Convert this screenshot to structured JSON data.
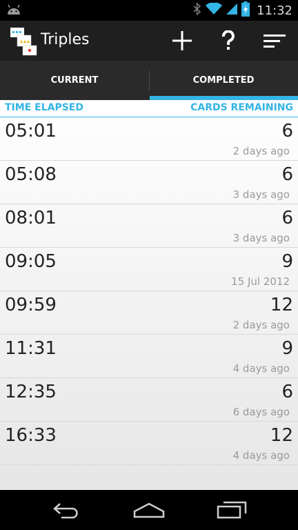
{
  "status_bar": {
    "time": "11:32",
    "icons": [
      "android-icon",
      "bluetooth-icon",
      "wifi-icon",
      "signal-icon",
      "battery-charging-icon"
    ]
  },
  "action_bar": {
    "app_title": "Triples",
    "buttons": [
      "add-icon",
      "help-icon",
      "sort-icon"
    ]
  },
  "tabs": [
    {
      "label": "CURRENT",
      "selected": false
    },
    {
      "label": "COMPLETED",
      "selected": true
    }
  ],
  "columns": {
    "left": "TIME ELAPSED",
    "right": "CARDS REMAINING"
  },
  "games": [
    {
      "time": "05:01",
      "cards": "6",
      "when": "2 days ago"
    },
    {
      "time": "05:08",
      "cards": "6",
      "when": "3 days ago"
    },
    {
      "time": "08:01",
      "cards": "6",
      "when": "3 days ago"
    },
    {
      "time": "09:05",
      "cards": "9",
      "when": "15 Jul 2012"
    },
    {
      "time": "09:59",
      "cards": "12",
      "when": "2 days ago"
    },
    {
      "time": "11:31",
      "cards": "9",
      "when": "4 days ago"
    },
    {
      "time": "12:35",
      "cards": "6",
      "when": "6 days ago"
    },
    {
      "time": "16:33",
      "cards": "12",
      "when": "4 days ago"
    }
  ],
  "nav_bar": [
    "back-icon",
    "home-icon",
    "recent-apps-icon"
  ],
  "colors": {
    "accent": "#33b5e5",
    "action_bar": "#1f1f1f",
    "tab_bar": "#2a2a2a"
  }
}
